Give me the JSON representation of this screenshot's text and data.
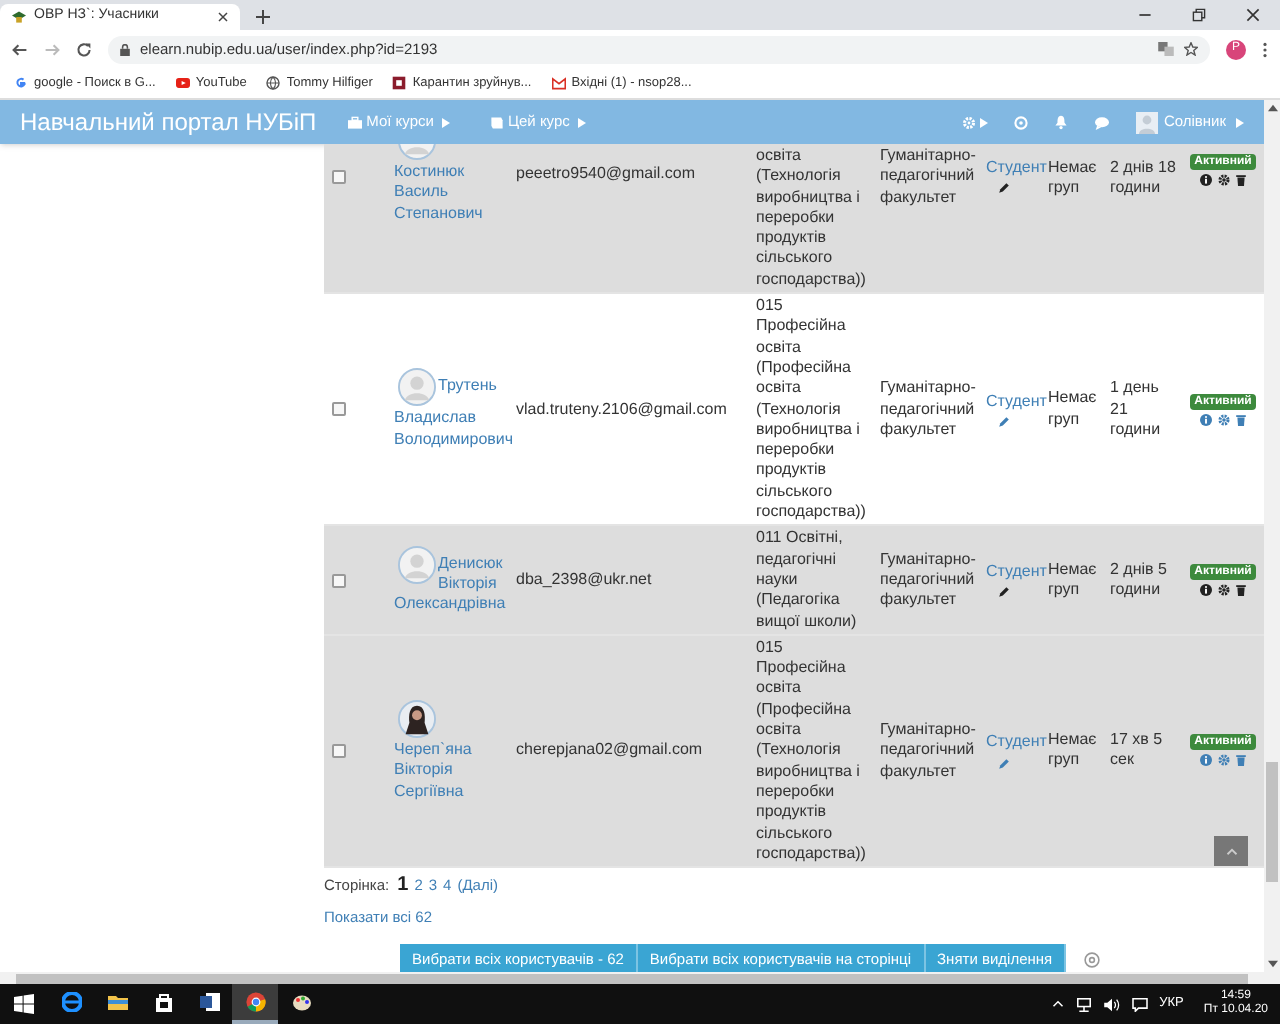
{
  "browser": {
    "tab_title": "ОВР НЗ`: Учасники",
    "url": "elearn.nubip.edu.ua/user/index.php?id=2193",
    "profile_initial": "P",
    "bookmarks": [
      {
        "kind": "google",
        "label": "google - Поиск в G..."
      },
      {
        "kind": "youtube",
        "label": "YouTube"
      },
      {
        "kind": "globe",
        "label": "Tommy Hilfiger"
      },
      {
        "kind": "app",
        "label": "Карантин зруйнув..."
      },
      {
        "kind": "gmail",
        "label": "Вхідні (1) - nsop28..."
      }
    ]
  },
  "navbar": {
    "title": "Навчальний портал НУБіП",
    "menus": [
      {
        "kind": "courses",
        "label": "Мої курси"
      },
      {
        "kind": "course",
        "label": "Цей курс"
      }
    ],
    "user": "Солівник"
  },
  "rows": [
    {
      "name": "Костинюк Василь Степанович",
      "avatar": {
        "kind": "default"
      },
      "email": "peeetro9540@gmail.com",
      "specialty": "освіта (Технологія виробництва і переробки продуктів сільського господарства))",
      "faculty": "Гуманітарно-педагогічний факультет",
      "role": "Студент",
      "groups": "Немає груп",
      "last_access": "2 днів 18 години",
      "status": "Активний",
      "checked": false,
      "highlighted": true,
      "muted_icons": true
    },
    {
      "name": "Трутень Владислав Володимирович",
      "avatar": {
        "kind": "default"
      },
      "email": "vlad.truteny.2106@gmail.com",
      "specialty": "015 Професійна освіта (Професійна освіта (Технологія виробництва і переробки продуктів сільського господарства))",
      "faculty": "Гуманітарно-педагогічний факультет",
      "role": "Студент",
      "groups": "Немає груп",
      "last_access": "1 день 21 години",
      "status": "Активний",
      "checked": false,
      "highlighted": false,
      "muted_icons": false
    },
    {
      "name": "Денисюк Вікторія Олександрівна",
      "avatar": {
        "kind": "default"
      },
      "email": "dba_2398@ukr.net",
      "specialty": "011 Освітні, педагогічні науки (Педагогіка вищої школи)",
      "faculty": "Гуманітарно-педагогічний факультет",
      "role": "Студент",
      "groups": "Немає груп",
      "last_access": "2 днів 5 години",
      "status": "Активний",
      "checked": false,
      "highlighted": true,
      "muted_icons": true
    },
    {
      "name": "Череп`яна Вікторія Сергіївна",
      "avatar": {
        "kind": "photo"
      },
      "email": "cherepjana02@gmail.com",
      "specialty": "015 Професійна освіта (Професійна освіта (Технологія виробництва і переробки продуктів сільського господарства))",
      "faculty": "Гуманітарно-педагогічний факультет",
      "role": "Студент",
      "groups": "Немає груп",
      "last_access": "17 хв 5 сек",
      "status": "Активний",
      "checked": false,
      "highlighted": true,
      "muted_icons": false
    }
  ],
  "pagination": {
    "label": "Сторінка:",
    "pages": [
      {
        "label": "1",
        "selected": true
      },
      {
        "label": "2",
        "selected": false
      },
      {
        "label": "3",
        "selected": false
      },
      {
        "label": "4",
        "selected": false
      }
    ],
    "next": "(Далі)"
  },
  "show_all": "Показати всі 62",
  "buttons": [
    "Вибрати всіх користувачів - 62",
    "Вибрати всіх користувачів на сторінці",
    "Зняти виділення"
  ],
  "taskbar": {
    "apps": [
      {
        "kind": "edge",
        "active": false
      },
      {
        "kind": "explorer",
        "active": false
      },
      {
        "kind": "store",
        "active": false
      },
      {
        "kind": "word",
        "active": false
      },
      {
        "kind": "chrome",
        "active": true
      },
      {
        "kind": "paint",
        "active": false
      }
    ],
    "language": "УКР",
    "time": "14:59",
    "date": "Пт 10.04.20"
  }
}
